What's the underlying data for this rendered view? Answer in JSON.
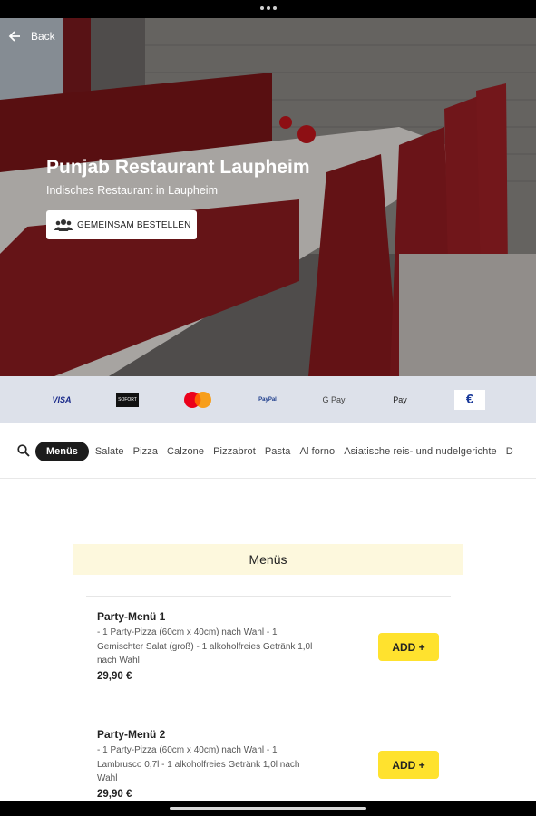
{
  "header": {
    "back_label": "Back"
  },
  "restaurant": {
    "name": "Punjab Restaurant Laupheim",
    "subtitle": "Indisches Restaurant in Laupheim",
    "group_order_label": "GEMEINSAM BESTELLEN"
  },
  "payments": {
    "visa": "VISA",
    "sofort": "SOFORT",
    "mastercard": "MasterCard",
    "paypal": "PayPal",
    "gpay": "G Pay",
    "apay": " Pay",
    "euro": "€"
  },
  "categories": {
    "active": "Menüs",
    "items": [
      "Salate",
      "Pizza",
      "Calzone",
      "Pizzabrot",
      "Pasta",
      "Al forno",
      "Asiatische reis- und nudelgerichte",
      "D"
    ]
  },
  "section": {
    "title": "Menüs"
  },
  "menu_items": [
    {
      "name": "Party-Menü 1",
      "description": "- 1 Party-Pizza (60cm x 40cm) nach Wahl - 1 Gemischter Salat (groß) - 1 alkoholfreies Getränk 1,0l nach Wahl",
      "price": "29,90 €",
      "add_label": "ADD +"
    },
    {
      "name": "Party-Menü 2",
      "description": "- 1 Party-Pizza (60cm x 40cm) nach Wahl - 1 Lambrusco 0,7l - 1 alkoholfreies Getränk 1,0l nach Wahl",
      "price": "29,90 €",
      "add_label": "ADD +"
    }
  ],
  "colors": {
    "accent_yellow": "#ffe22e",
    "section_bg": "#fdf8dd",
    "payments_bg": "#dde1ea",
    "active_category_bg": "#1c1c1c"
  }
}
